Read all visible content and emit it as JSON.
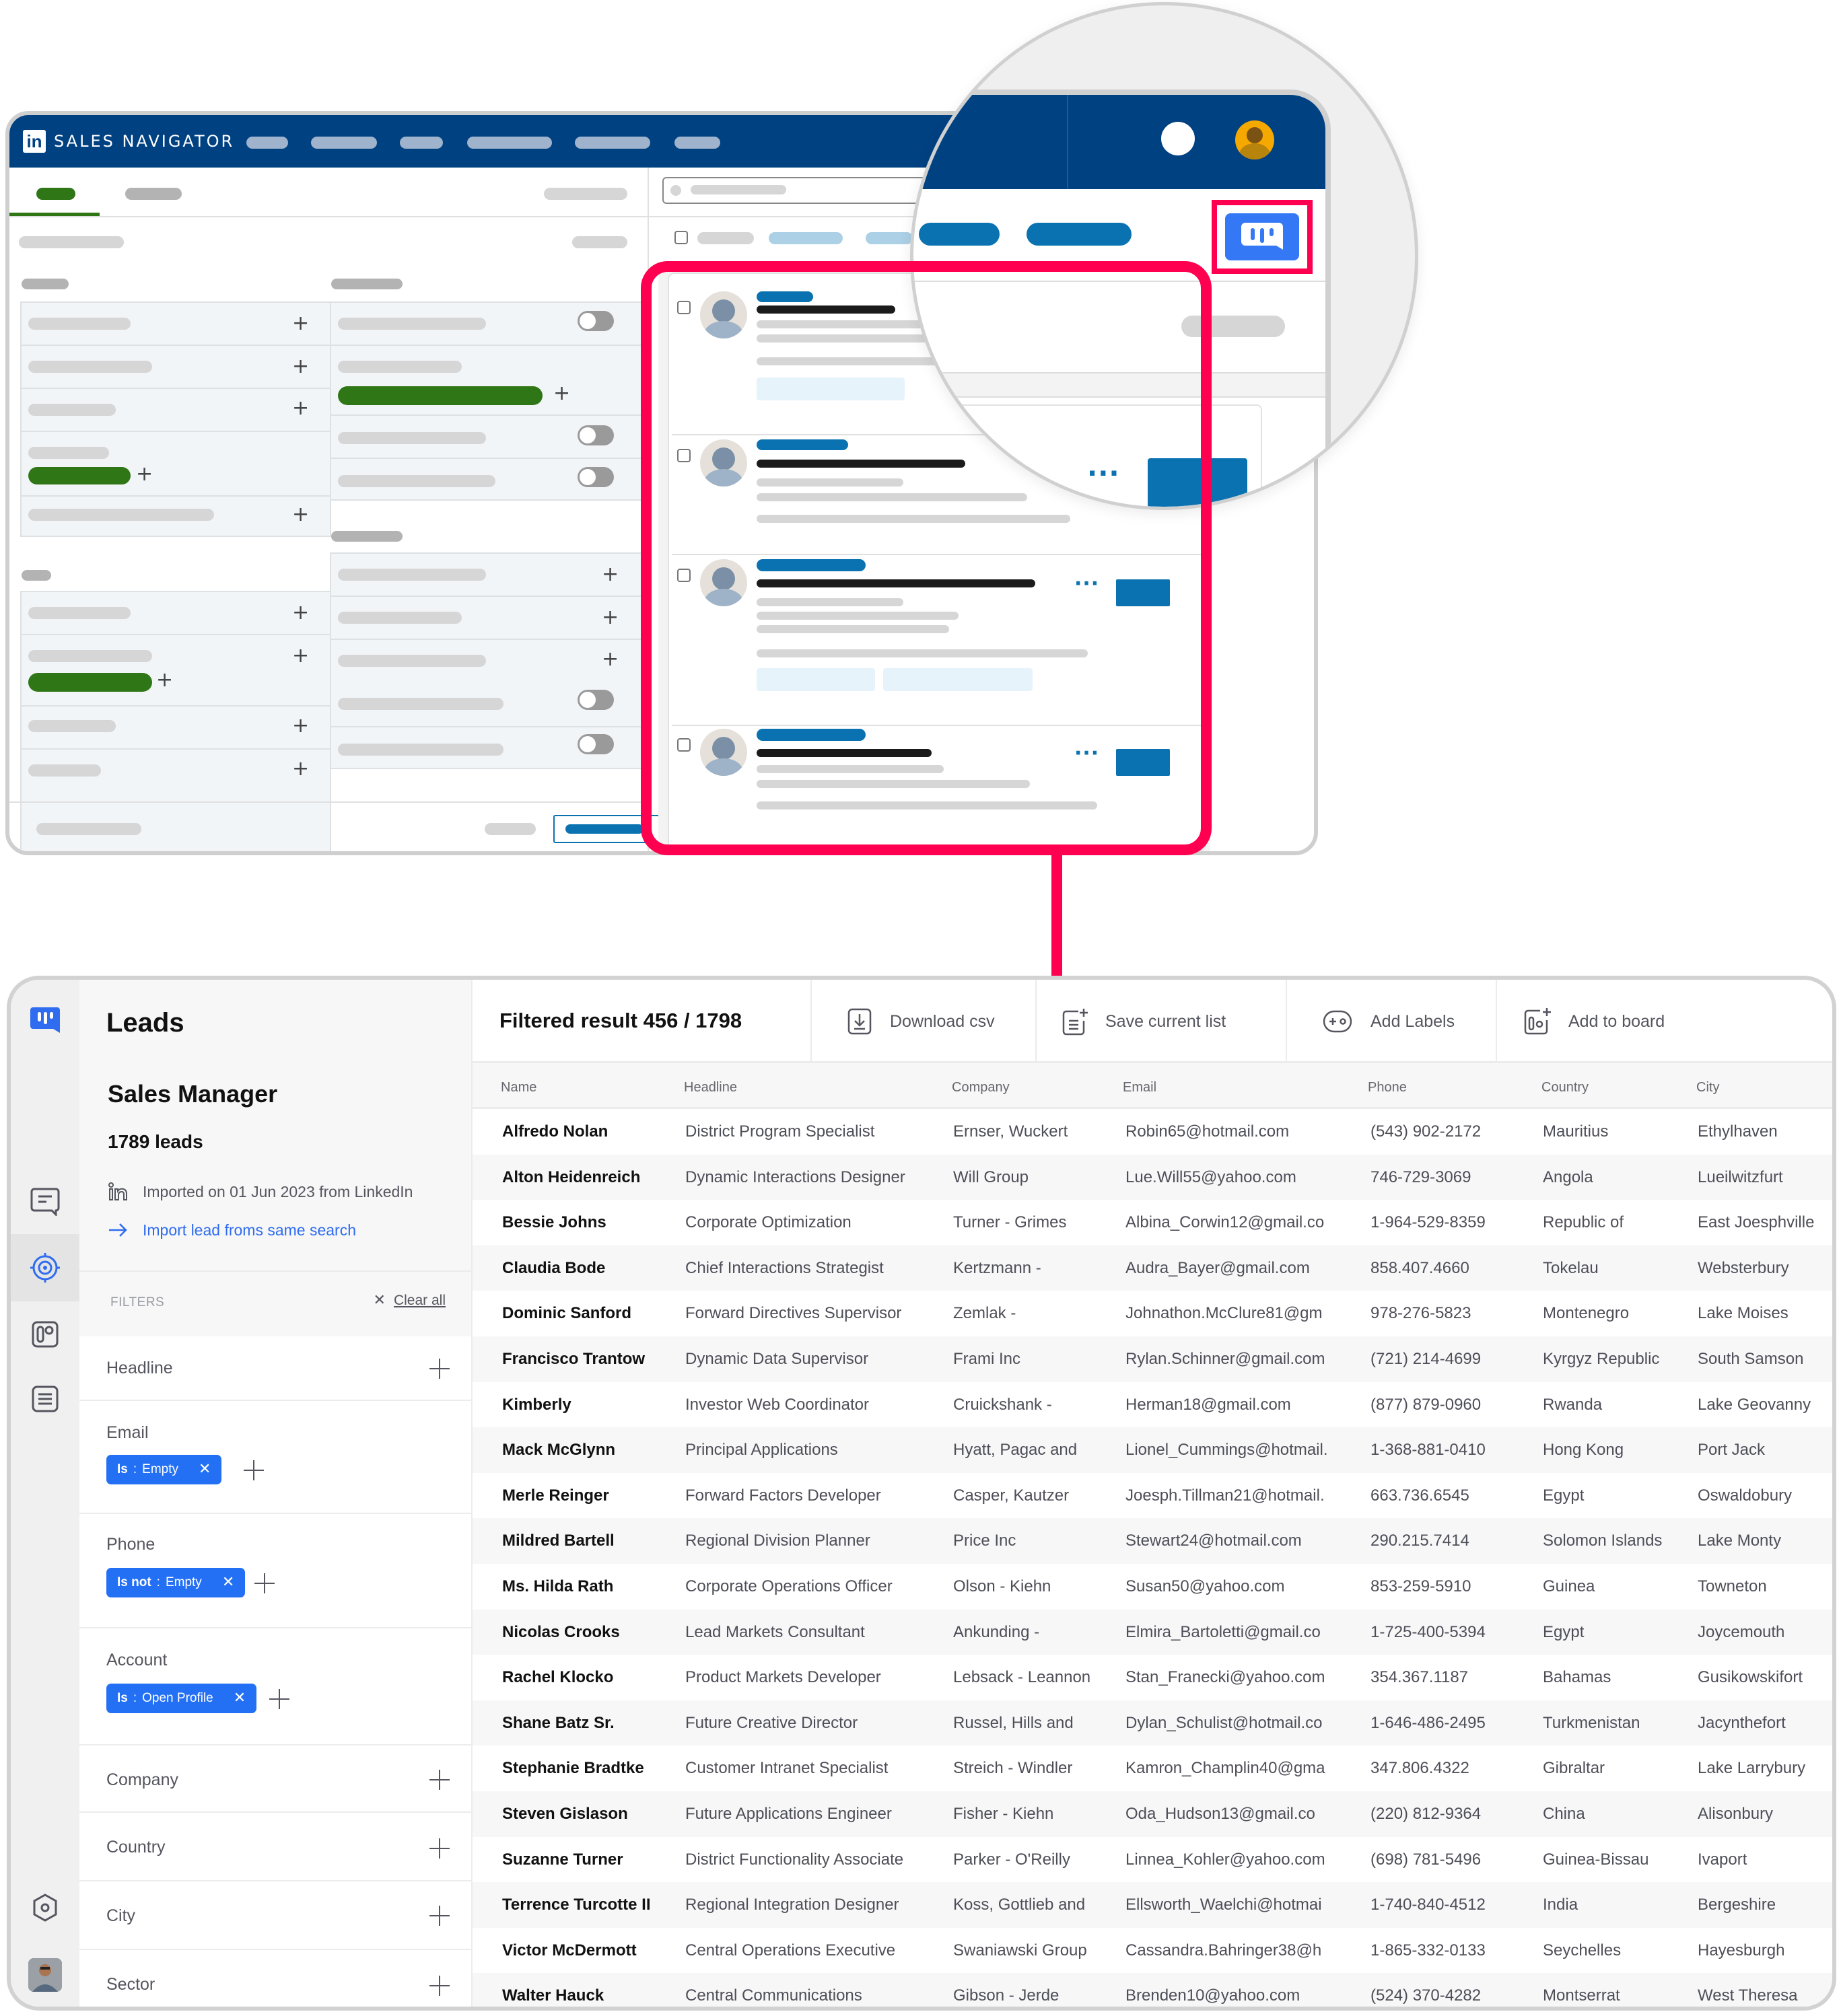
{
  "mockup": {
    "brand": "SALES NAVIGATOR",
    "logo_text": "in",
    "highlight_color": "#ff0050",
    "navy": "#004182",
    "linkedin_blue": "#0a72b0"
  },
  "app": {
    "accent": "#2470f5",
    "sidebar": {
      "title": "Leads",
      "list_name": "Sales Manager",
      "lead_count": "1789 leads",
      "import_info": "Imported on 01 Jun 2023 from LinkedIn",
      "import_link": "Import lead froms same search",
      "filters_label": "FILTERS",
      "clear_all": "Clear all",
      "rail_icons": [
        "brand-logo-icon",
        "message-icon",
        "target-icon",
        "board-icon",
        "list-icon",
        "settings-icon",
        "user-avatar"
      ],
      "filters": [
        {
          "label": "Headline",
          "chips": []
        },
        {
          "label": "Email",
          "chips": [
            {
              "op": "Is",
              "value": "Empty"
            }
          ]
        },
        {
          "label": "Phone",
          "chips": [
            {
              "op": "Is not",
              "value": "Empty"
            }
          ]
        },
        {
          "label": "Account",
          "chips": [
            {
              "op": "Is",
              "value": "Open Profile"
            }
          ]
        },
        {
          "label": "Company",
          "chips": []
        },
        {
          "label": "Country",
          "chips": []
        },
        {
          "label": "City",
          "chips": []
        },
        {
          "label": "Sector",
          "chips": []
        }
      ]
    },
    "toolbar": {
      "result": "Filtered result 456 / 1798",
      "download_csv": "Download csv",
      "save_list": "Save current list",
      "add_labels": "Add Labels",
      "add_to_board": "Add to board"
    },
    "table": {
      "columns": [
        "Name",
        "Headline",
        "Company",
        "Email",
        "Phone",
        "Country",
        "City"
      ],
      "rows": [
        [
          "Alfredo Nolan",
          "District Program Specialist",
          "Ernser, Wuckert",
          "Robin65@hotmail.com",
          "(543) 902-2172",
          "Mauritius",
          "Ethylhaven"
        ],
        [
          "Alton Heidenreich",
          "Dynamic Interactions Designer",
          "Will Group",
          "Lue.Will55@yahoo.com",
          "746-729-3069",
          "Angola",
          "Lueilwitzfurt"
        ],
        [
          "Bessie Johns",
          "Corporate Optimization",
          "Turner - Grimes",
          "Albina_Corwin12@gmail.co",
          "1-964-529-8359",
          "Republic of",
          "East Joesphville"
        ],
        [
          "Claudia Bode",
          "Chief Interactions Strategist",
          "Kertzmann -",
          "Audra_Bayer@gmail.com",
          "858.407.4660",
          "Tokelau",
          "Websterbury"
        ],
        [
          "Dominic Sanford",
          "Forward Directives Supervisor",
          "Zemlak -",
          "Johnathon.McClure81@gm",
          "978-276-5823",
          "Montenegro",
          "Lake Moises"
        ],
        [
          "Francisco Trantow",
          "Dynamic Data Supervisor",
          "Frami Inc",
          "Rylan.Schinner@gmail.com",
          "(721) 214-4699",
          "Kyrgyz Republic",
          "South Samson"
        ],
        [
          "Kimberly",
          "Investor Web Coordinator",
          "Cruickshank -",
          "Herman18@gmail.com",
          "(877) 879-0960",
          "Rwanda",
          "Lake Geovanny"
        ],
        [
          "Mack McGlynn",
          "Principal Applications",
          "Hyatt, Pagac and",
          "Lionel_Cummings@hotmail.",
          "1-368-881-0410",
          "Hong Kong",
          "Port Jack"
        ],
        [
          "Merle Reinger",
          "Forward Factors Developer",
          "Casper, Kautzer",
          "Joesph.Tillman21@hotmail.",
          "663.736.6545",
          "Egypt",
          "Oswaldobury"
        ],
        [
          "Mildred Bartell",
          "Regional Division Planner",
          "Price Inc",
          "Stewart24@hotmail.com",
          "290.215.7414",
          "Solomon Islands",
          "Lake Monty"
        ],
        [
          "Ms. Hilda Rath",
          "Corporate Operations Officer",
          "Olson - Kiehn",
          "Susan50@yahoo.com",
          "853-259-5910",
          "Guinea",
          "Towneton"
        ],
        [
          "Nicolas Crooks",
          "Lead Markets Consultant",
          "Ankunding -",
          "Elmira_Bartoletti@gmail.co",
          "1-725-400-5394",
          "Egypt",
          "Joycemouth"
        ],
        [
          "Rachel Klocko",
          "Product Markets Developer",
          "Lebsack - Leannon",
          "Stan_Franecki@yahoo.com",
          "354.367.1187",
          "Bahamas",
          "Gusikowskifort"
        ],
        [
          "Shane Batz Sr.",
          "Future Creative Director",
          "Russel, Hills and",
          "Dylan_Schulist@hotmail.co",
          "1-646-486-2495",
          "Turkmenistan",
          "Jacynthefort"
        ],
        [
          "Stephanie Bradtke",
          "Customer Intranet Specialist",
          "Streich - Windler",
          "Kamron_Champlin40@gma",
          "347.806.4322",
          "Gibraltar",
          "Lake Larrybury"
        ],
        [
          "Steven Gislason",
          "Future Applications Engineer",
          "Fisher - Kiehn",
          "Oda_Hudson13@gmail.co",
          "(220) 812-9364",
          "China",
          "Alisonbury"
        ],
        [
          "Suzanne Turner",
          "District Functionality Associate",
          "Parker - O'Reilly",
          "Linnea_Kohler@yahoo.com",
          "(698) 781-5496",
          "Guinea-Bissau",
          "Ivaport"
        ],
        [
          "Terrence Turcotte II",
          "Regional Integration Designer",
          "Koss, Gottlieb and",
          "Ellsworth_Waelchi@hotmai",
          "1-740-840-4512",
          "India",
          "Bergeshire"
        ],
        [
          "Victor McDermott",
          "Central Operations Executive",
          "Swaniawski Group",
          "Cassandra.Bahringer38@h",
          "1-865-332-0133",
          "Seychelles",
          "Hayesburgh"
        ],
        [
          "Walter Hauck",
          "Central Communications",
          "Gibson - Jerde",
          "Brenden10@yahoo.com",
          "(524) 370-4282",
          "Montserrat",
          "West Theresa"
        ]
      ]
    }
  }
}
